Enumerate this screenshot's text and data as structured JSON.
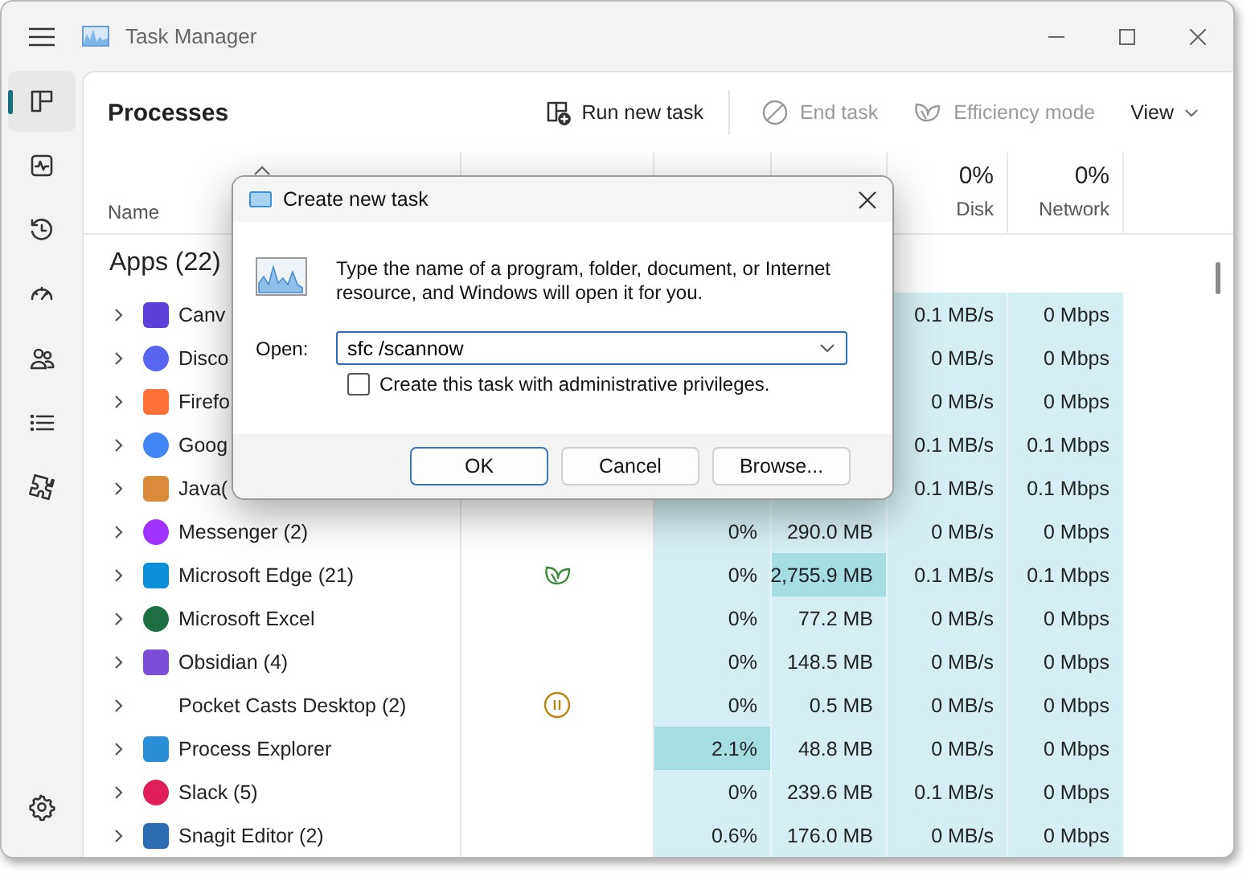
{
  "window": {
    "title": "Task Manager"
  },
  "nav_items": [
    {
      "selected": true
    },
    {
      "selected": false
    },
    {
      "selected": false
    },
    {
      "selected": false
    },
    {
      "selected": false
    },
    {
      "selected": false
    },
    {
      "selected": false
    }
  ],
  "settings": {
    "selected": false
  },
  "page_title": "Processes",
  "toolbar": [
    {
      "label": "Run new task",
      "disabled": false
    },
    {
      "label": "End task",
      "disabled": true
    },
    {
      "label": "Efficiency mode",
      "disabled": true
    },
    {
      "label": "View",
      "disabled": false
    }
  ],
  "table": {
    "columns": [
      {
        "label": "Name",
        "sorted": true
      },
      {
        "percent": "0%",
        "label": "Disk"
      },
      {
        "percent": "0%",
        "label": "Network"
      }
    ],
    "group": "Apps (22)",
    "rows": [
      {
        "name": "Canv",
        "color": "#5b3fd6",
        "expanded": false,
        "disk": {
          "text": "0.1 MB/s",
          "hot": false
        },
        "network": {
          "text": "0 Mbps",
          "hot": false
        }
      },
      {
        "name": "Disco",
        "color": "#5865f2",
        "expanded": false,
        "disk": {
          "text": "0 MB/s",
          "hot": false
        },
        "network": {
          "text": "0 Mbps",
          "hot": false
        }
      },
      {
        "name": "Firefo",
        "color": "#ff7139",
        "expanded": false,
        "disk": {
          "text": "0 MB/s",
          "hot": false
        },
        "network": {
          "text": "0 Mbps",
          "hot": false
        }
      },
      {
        "name": "Goog",
        "color": "#4285f4",
        "expanded": false,
        "disk": {
          "text": "0.1 MB/s",
          "hot": false
        },
        "network": {
          "text": "0.1 Mbps",
          "hot": false
        }
      },
      {
        "name": "Java(",
        "color": "#d98b3a",
        "expanded": false,
        "disk": {
          "text": "0.1 MB/s",
          "hot": false
        },
        "network": {
          "text": "0.1 Mbps",
          "hot": false
        }
      },
      {
        "name": "Messenger (2)",
        "color": "#a033ff",
        "expanded": false,
        "cpu": {
          "text": "0%",
          "hot": false
        },
        "memory": {
          "text": "290.0 MB",
          "hot": false
        },
        "disk": {
          "text": "0 MB/s",
          "hot": false
        },
        "network": {
          "text": "0 Mbps",
          "hot": false
        }
      },
      {
        "name": "Microsoft Edge (21)",
        "color": "#0c8fd9",
        "expanded": false,
        "status_icon": {
          "kind": "efficiency"
        },
        "cpu": {
          "text": "0%",
          "hot": false
        },
        "memory": {
          "text": "2,755.9 MB",
          "hot": true
        },
        "disk": {
          "text": "0.1 MB/s",
          "hot": false
        },
        "network": {
          "text": "0.1 Mbps",
          "hot": false
        }
      },
      {
        "name": "Microsoft Excel",
        "color": "#1d6f42",
        "expanded": false,
        "cpu": {
          "text": "0%",
          "hot": false
        },
        "memory": {
          "text": "77.2 MB",
          "hot": false
        },
        "disk": {
          "text": "0 MB/s",
          "hot": false
        },
        "network": {
          "text": "0 Mbps",
          "hot": false
        }
      },
      {
        "name": "Obsidian (4)",
        "color": "#7c4dd6",
        "expanded": false,
        "cpu": {
          "text": "0%",
          "hot": false
        },
        "memory": {
          "text": "148.5 MB",
          "hot": false
        },
        "disk": {
          "text": "0 MB/s",
          "hot": false
        },
        "network": {
          "text": "0 Mbps",
          "hot": false
        }
      },
      {
        "name": "Pocket Casts Desktop (2)",
        "expanded": false,
        "status_icon": {
          "kind": "suspended"
        },
        "cpu": {
          "text": "0%",
          "hot": false
        },
        "memory": {
          "text": "0.5 MB",
          "hot": false
        },
        "disk": {
          "text": "0 MB/s",
          "hot": false
        },
        "network": {
          "text": "0 Mbps",
          "hot": false
        }
      },
      {
        "name": "Process Explorer",
        "color": "#2a8fd6",
        "expanded": false,
        "cpu": {
          "text": "2.1%",
          "hot": true
        },
        "memory": {
          "text": "48.8 MB",
          "hot": false
        },
        "disk": {
          "text": "0 MB/s",
          "hot": false
        },
        "network": {
          "text": "0 Mbps",
          "hot": false
        }
      },
      {
        "name": "Slack (5)",
        "color": "#e01e5a",
        "expanded": false,
        "cpu": {
          "text": "0%",
          "hot": false
        },
        "memory": {
          "text": "239.6 MB",
          "hot": false
        },
        "disk": {
          "text": "0.1 MB/s",
          "hot": false
        },
        "network": {
          "text": "0 Mbps",
          "hot": false
        }
      },
      {
        "name": "Snagit Editor (2)",
        "color": "#2b6cb0",
        "expanded": false,
        "cpu": {
          "text": "0.6%",
          "hot": false
        },
        "memory": {
          "text": "176.0 MB",
          "hot": false
        },
        "disk": {
          "text": "0 MB/s",
          "hot": false
        },
        "network": {
          "text": "0 Mbps",
          "hot": false
        }
      }
    ]
  },
  "dialog": {
    "title": "Create new task",
    "message": "Type the name of a program, folder, document, or Internet resource, and Windows will open it for you.",
    "open_label": "Open:",
    "value": "sfc /scannow",
    "checkbox": {
      "label": "Create this task with administrative privileges.",
      "checked": false
    },
    "buttons": [
      {
        "label": "OK",
        "default": true
      },
      {
        "label": "Cancel",
        "default": false
      },
      {
        "label": "Browse...",
        "default": false
      }
    ]
  }
}
